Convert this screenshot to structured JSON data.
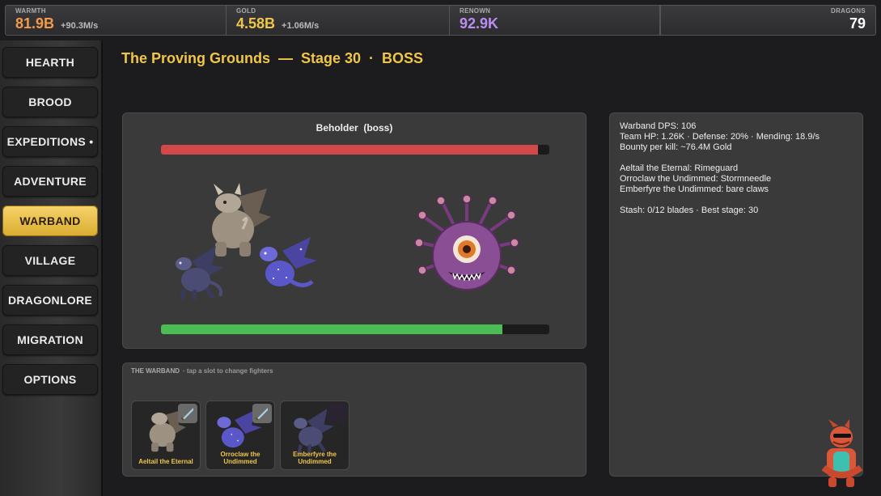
{
  "resources": {
    "warmth": {
      "label": "WARMTH",
      "value": "81.9B",
      "rate": "+90.3M/s",
      "color": "#f39a4a"
    },
    "gold": {
      "label": "GOLD",
      "value": "4.58B",
      "rate": "+1.06M/s",
      "color": "#f0c64a"
    },
    "renown": {
      "label": "RENOWN",
      "value": "92.9K",
      "color": "#b98ef0"
    },
    "dragons": {
      "label": "DRAGONS",
      "value": "79"
    }
  },
  "nav": {
    "items": [
      {
        "label": "HEARTH"
      },
      {
        "label": "BROOD"
      },
      {
        "label": "EXPEDITIONS •"
      },
      {
        "label": "ADVENTURE"
      },
      {
        "label": "WARBAND",
        "active": true
      },
      {
        "label": "VILLAGE"
      },
      {
        "label": "DRAGONLORE"
      },
      {
        "label": "MIGRATION"
      },
      {
        "label": "OPTIONS"
      }
    ]
  },
  "page": {
    "title": "The Proving Grounds  —  Stage 30  ·  BOSS"
  },
  "battle": {
    "enemy_name": "Beholder  (boss)",
    "enemy_hp_fraction": 0.97,
    "team_hp_fraction": 0.88,
    "accent_enemy_hp": "#d34848",
    "accent_team_hp": "#4cbc55"
  },
  "info": {
    "dps": "Warband DPS:  106",
    "team_line": "Team HP:  1.26K   ·   Defense:  20%   ·   Mending: 18.9/s",
    "bounty": "Bounty per kill:  ~76.4M Gold",
    "member1": "Aeltail the Eternal:  Rimeguard",
    "member2": "Orroclaw the Undimmed:  Stormneedle",
    "member3": "Emberfyre the Undimmed:  bare claws",
    "stash": "Stash:  0/12 blades   ·   Best stage:  30"
  },
  "warband": {
    "heading": "THE WARBAND",
    "hint": "·  tap a slot to change fighters",
    "slots": [
      {
        "name": "Aeltail the Eternal",
        "weapon_icon": "sword-icon"
      },
      {
        "name": "Orroclaw the Undimmed",
        "weapon_icon": "sword-icon"
      },
      {
        "name": "Emberfyre the Undimmed",
        "weapon_icon": "empty-slot-icon"
      }
    ]
  }
}
